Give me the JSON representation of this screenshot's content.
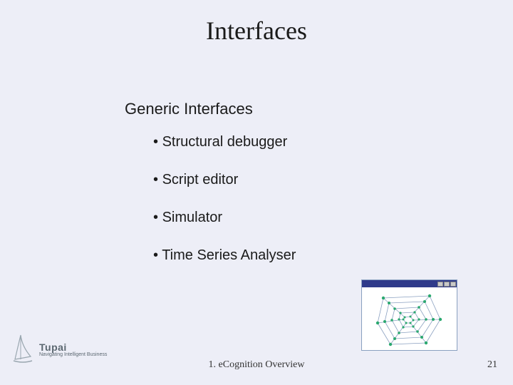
{
  "title": "Interfaces",
  "subtitle": "Generic Interfaces",
  "bullets": [
    "Structural debugger",
    "Script editor",
    "Simulator",
    "Time Series Analyser"
  ],
  "footer": "1. eCognition Overview",
  "pageNumber": "21",
  "logo": {
    "brand": "Tupai",
    "tagline": "Navigating Intelligent Business"
  },
  "colors": {
    "background": "#edeef7",
    "thumbTitlebar": "#2f3a8a",
    "node": "#2aa86f",
    "edge": "#8aa0c0"
  }
}
